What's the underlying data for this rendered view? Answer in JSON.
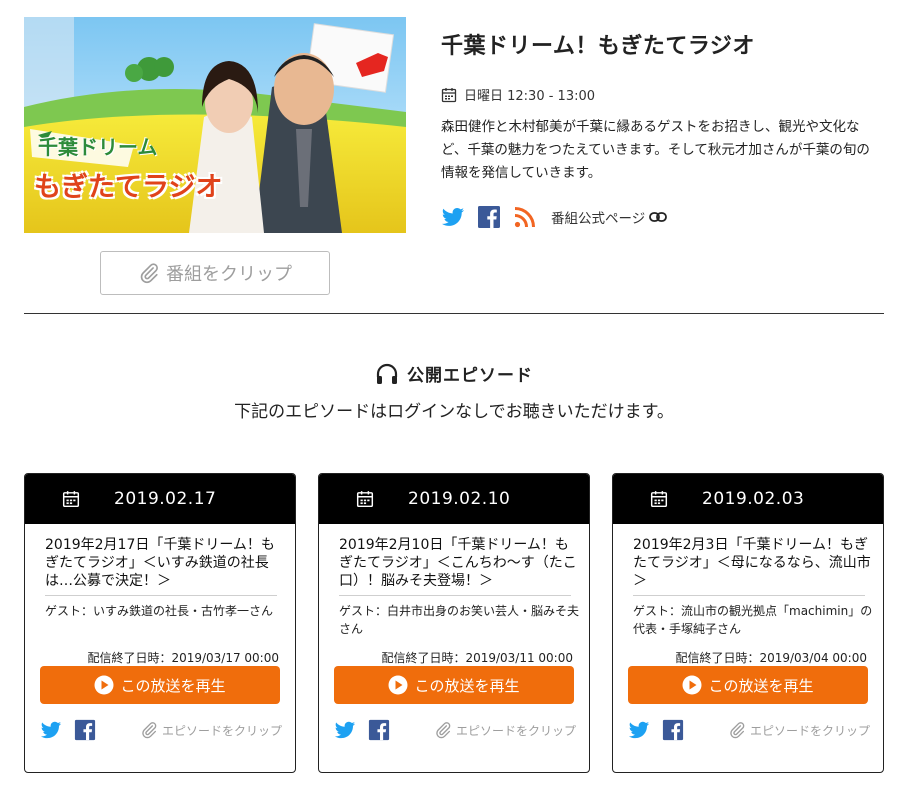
{
  "program": {
    "title": "千葉ドリーム！もぎたてラジオ",
    "schedule": "日曜日 12:30 - 13:00",
    "description": "森田健作と木村郁美が千葉に縁あるゲストをお招きし、観光や文化など、千葉の魅力をつたえていきます。そして秋元才加さんが千葉の旬の情報を発信していきます。",
    "official_label": "番組公式ページ",
    "clip_label": "番組をクリップ",
    "logo_line1": "千葉ドリーム",
    "logo_line2": "もぎたてラジオ"
  },
  "episodes_section": {
    "heading": "公開エピソード",
    "subtitle": "下記のエピソードはログインなしでお聴きいただけます。"
  },
  "episodes": [
    {
      "date": "2019.02.17",
      "title": "2019年2月17日「千葉ドリーム！もぎたてラジオ」＜いすみ鉄道の社長は…公募で決定！＞",
      "guest": "ゲスト：いすみ鉄道の社長・古竹孝一さん",
      "expire": "配信終了日時：2019/03/17 00:00",
      "play_label": "この放送を再生",
      "clip_label": "エピソードをクリップ"
    },
    {
      "date": "2019.02.10",
      "title": "2019年2月10日「千葉ドリーム！もぎたてラジオ」＜こんちわ～す（たこ口）！脳みそ夫登場！＞",
      "guest": "ゲスト：白井市出身のお笑い芸人・脳みそ夫さん",
      "expire": "配信終了日時：2019/03/11 00:00",
      "play_label": "この放送を再生",
      "clip_label": "エピソードをクリップ"
    },
    {
      "date": "2019.02.03",
      "title": "2019年2月3日「千葉ドリーム！もぎたてラジオ」＜母になるなら、流山市＞",
      "guest": "ゲスト：流山市の観光拠点「machimin」の代表・手塚純子さん",
      "expire": "配信終了日時：2019/03/04 00:00",
      "play_label": "この放送を再生",
      "clip_label": "エピソードをクリップ"
    }
  ],
  "colors": {
    "accent_orange": "#f06d0c",
    "twitter_blue": "#1da1f2",
    "facebook_blue": "#3b5998",
    "rss_orange": "#f26522",
    "card_header": "#000000"
  },
  "icons": {
    "calendar": "calendar-icon",
    "twitter": "twitter-icon",
    "facebook": "facebook-icon",
    "rss": "rss-icon",
    "link": "link-icon",
    "paperclip": "paperclip-icon",
    "headphones": "headphones-icon",
    "play": "play-icon"
  }
}
